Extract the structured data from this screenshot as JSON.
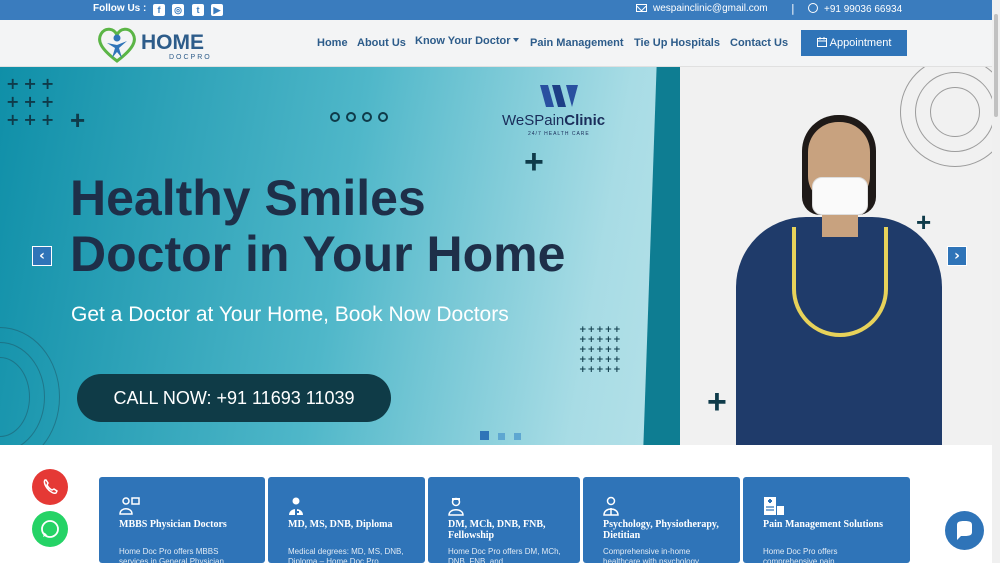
{
  "topbar": {
    "follow_label": "Follow Us :",
    "social": [
      {
        "name": "facebook-icon",
        "glyph": "f"
      },
      {
        "name": "instagram-icon",
        "glyph": "◎"
      },
      {
        "name": "twitter-icon",
        "glyph": "t"
      },
      {
        "name": "youtube-icon",
        "glyph": "▶"
      }
    ],
    "email": "wespainclinic@gmail.com",
    "separator": "|",
    "phone": "+91 99036 66934"
  },
  "header": {
    "logo_main": "HOME",
    "logo_sub": "DOCPRO",
    "nav": [
      {
        "label": "Home"
      },
      {
        "label": "About Us"
      },
      {
        "label": "Know Your Doctor",
        "dropdown": true
      },
      {
        "label": "Pain Management"
      },
      {
        "label": "Tie Up Hospitals"
      },
      {
        "label": "Contact Us"
      }
    ],
    "appointment_label": "Appointment"
  },
  "hero": {
    "brand_name_light": "WeSPain",
    "brand_name_bold": "Clinic",
    "brand_tagline": "24/7 HEALTH CARE",
    "headline_line1": "Healthy Smiles",
    "headline_line2": "Doctor in Your Home",
    "subline": "Get a Doctor at Your Home, Book Now Doctors",
    "call_label": "CALL NOW: +91 11693 11039",
    "slides_count": 3,
    "active_slide": 1,
    "prev_glyph": "‹",
    "next_glyph": "›"
  },
  "cards": [
    {
      "title": "MBBS Physician Doctors",
      "desc": "Home Doc Pro offers MBBS services in General Physician",
      "icon": "doctors-group-icon"
    },
    {
      "title": "MD, MS, DNB, Diploma",
      "desc": "Medical degrees: MD, MS, DNB, Diploma – Home Doc Pro",
      "icon": "doctor-icon"
    },
    {
      "title": "DM, MCh, DNB, FNB, Fellowship",
      "desc": "Home Doc Pro offers DM, MCh, DNB, FNB, and",
      "icon": "nurse-icon"
    },
    {
      "title": "Psychology, Physiotherapy, Dietitian",
      "desc": "Comprehensive in-home healthcare with psychology",
      "icon": "therapist-icon"
    },
    {
      "title": "Pain Management Solutions",
      "desc": "Home Doc Pro offers comprehensive pain",
      "icon": "medical-clipboard-icon"
    }
  ],
  "colors": {
    "primary": "#2f74b8",
    "topbar": "#3a7cbe",
    "dark_teal": "#0f3b47",
    "call_fab": "#e53935",
    "whatsapp_fab": "#25d366",
    "chat_fab": "#2f74b8"
  }
}
